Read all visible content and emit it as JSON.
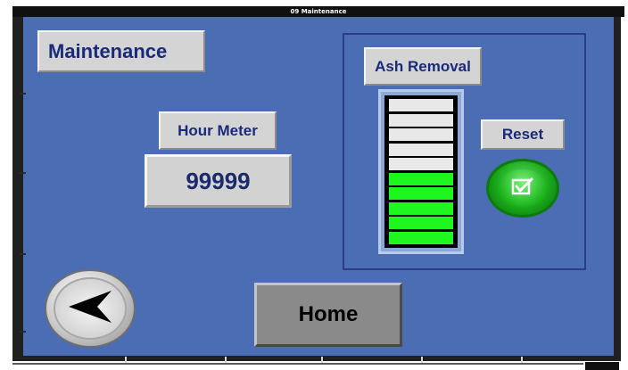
{
  "window": {
    "title": "09 Maintenance"
  },
  "screen": {
    "title": "Maintenance"
  },
  "hour_meter": {
    "label": "Hour Meter",
    "value": "99999"
  },
  "ash_removal": {
    "label": "Ash Removal",
    "segments_total": 10,
    "segments_filled": 5,
    "level_fraction": 0.5,
    "fill_color": "#1ff51f",
    "empty_color": "#e8e8e8"
  },
  "reset": {
    "label": "Reset",
    "icon": "checkbox-check-icon"
  },
  "navigation": {
    "back_icon": "arrow-left-icon",
    "home_label": "Home"
  },
  "colors": {
    "panel_background": "#4a6db4",
    "label_background": "#d4d4d4",
    "label_text": "#1a2a7a",
    "home_button": "#8a8a8a"
  }
}
